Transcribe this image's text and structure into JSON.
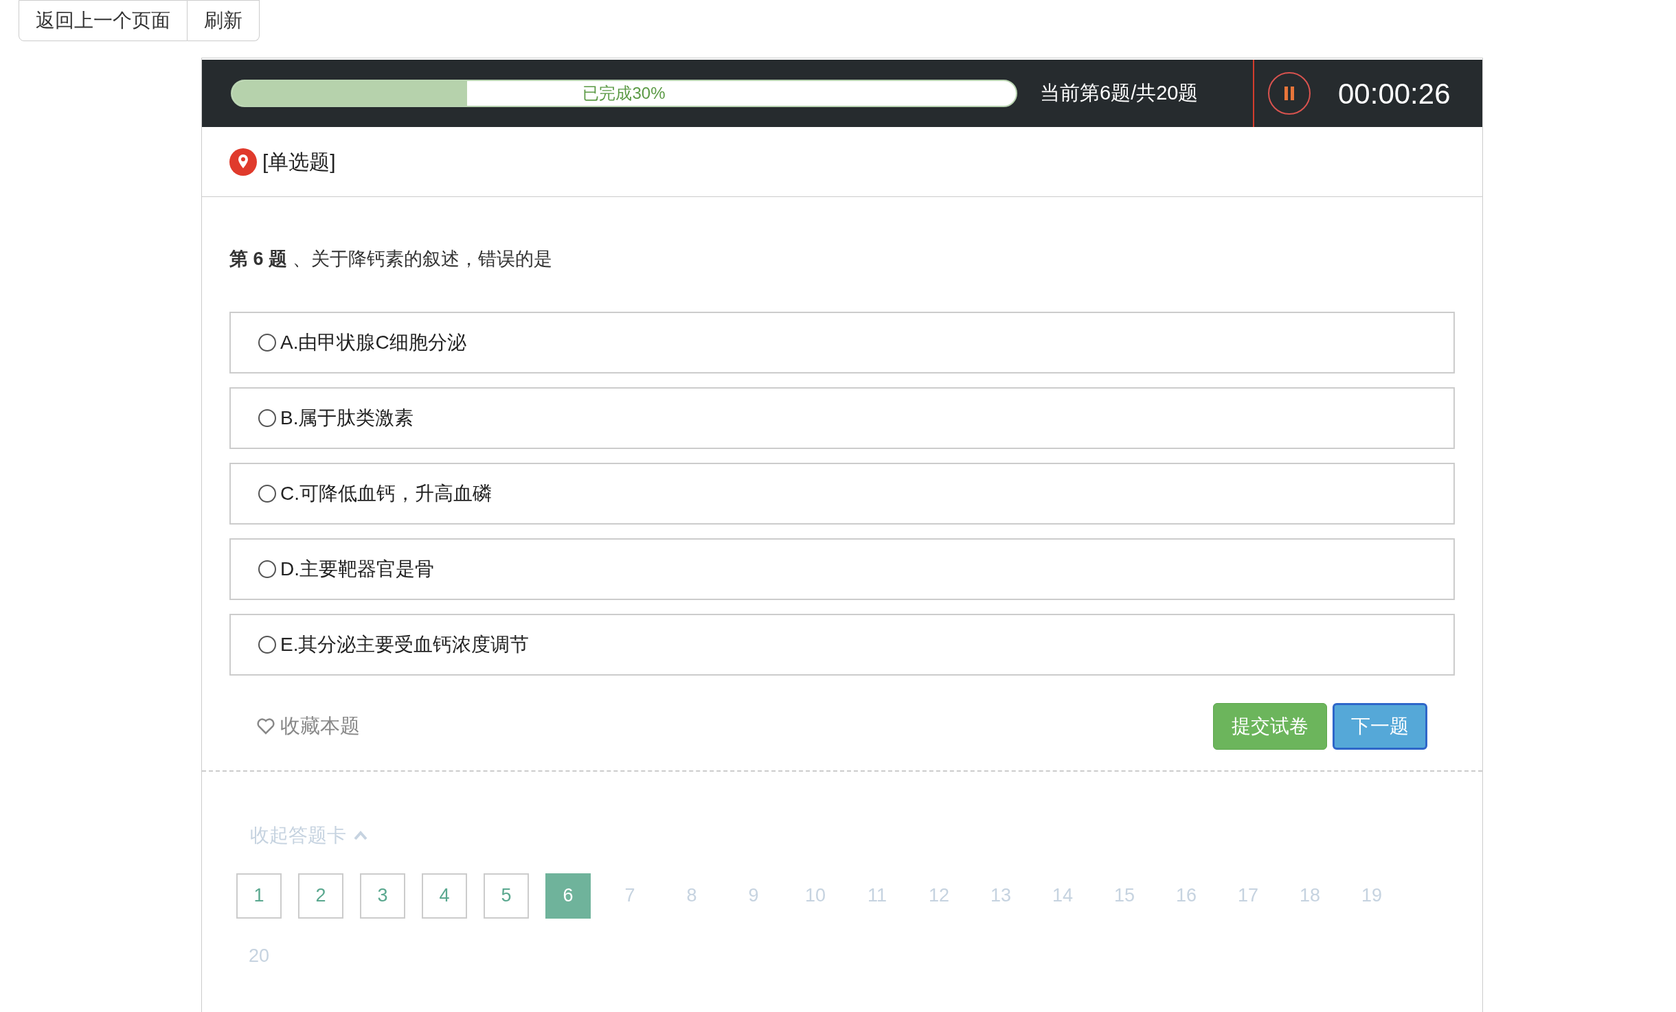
{
  "top_buttons": [
    "返回上一个页面",
    "刷新"
  ],
  "progress": {
    "label": "已完成30%",
    "level": 0.3
  },
  "counter": "当前第6题/共20题",
  "timer": "00:00:26",
  "question_type": "[单选题]",
  "question": "**第 6 题** 、关于降钙素的叙述，错误的是",
  "options": [
    {
      "label": "A.由甲状腺C细胞分泌",
      "selected": false
    },
    {
      "label": "B.属于肽类激素",
      "selected": false
    },
    {
      "label": "C.可降低血钙，升高血磷",
      "selected": false
    },
    {
      "label": "D.主要靶器官是骨",
      "selected": false
    },
    {
      "label": "E.其分泌主要受血钙浓度调节",
      "selected": false
    }
  ],
  "favorite": {
    "label": "收藏本题",
    "checked": false
  },
  "submit_button": "提交试卷",
  "next_button": "下一题",
  "answer_card": {
    "toggle": "收起答题卡",
    "expanded": true,
    "items": [
      {
        "label": "1",
        "answered": true,
        "selected": false
      },
      {
        "label": "2",
        "answered": true,
        "selected": false
      },
      {
        "label": "3",
        "answered": true,
        "selected": false
      },
      {
        "label": "4",
        "answered": true,
        "selected": false
      },
      {
        "label": "5",
        "answered": true,
        "selected": false
      },
      {
        "label": "6",
        "answered": false,
        "selected": true
      },
      {
        "label": "7",
        "answered": false,
        "selected": false
      },
      {
        "label": "8",
        "answered": false,
        "selected": false
      },
      {
        "label": "9",
        "answered": false,
        "selected": false
      },
      {
        "label": "10",
        "answered": false,
        "selected": false
      },
      {
        "label": "11",
        "answered": false,
        "selected": false
      },
      {
        "label": "12",
        "answered": false,
        "selected": false
      },
      {
        "label": "13",
        "answered": false,
        "selected": false
      },
      {
        "label": "14",
        "answered": false,
        "selected": false
      },
      {
        "label": "15",
        "answered": false,
        "selected": false
      },
      {
        "label": "16",
        "answered": false,
        "selected": false
      },
      {
        "label": "17",
        "answered": false,
        "selected": false
      },
      {
        "label": "18",
        "answered": false,
        "selected": false
      },
      {
        "label": "19",
        "answered": false,
        "selected": false
      },
      {
        "label": "20",
        "answered": false,
        "selected": false
      }
    ]
  }
}
